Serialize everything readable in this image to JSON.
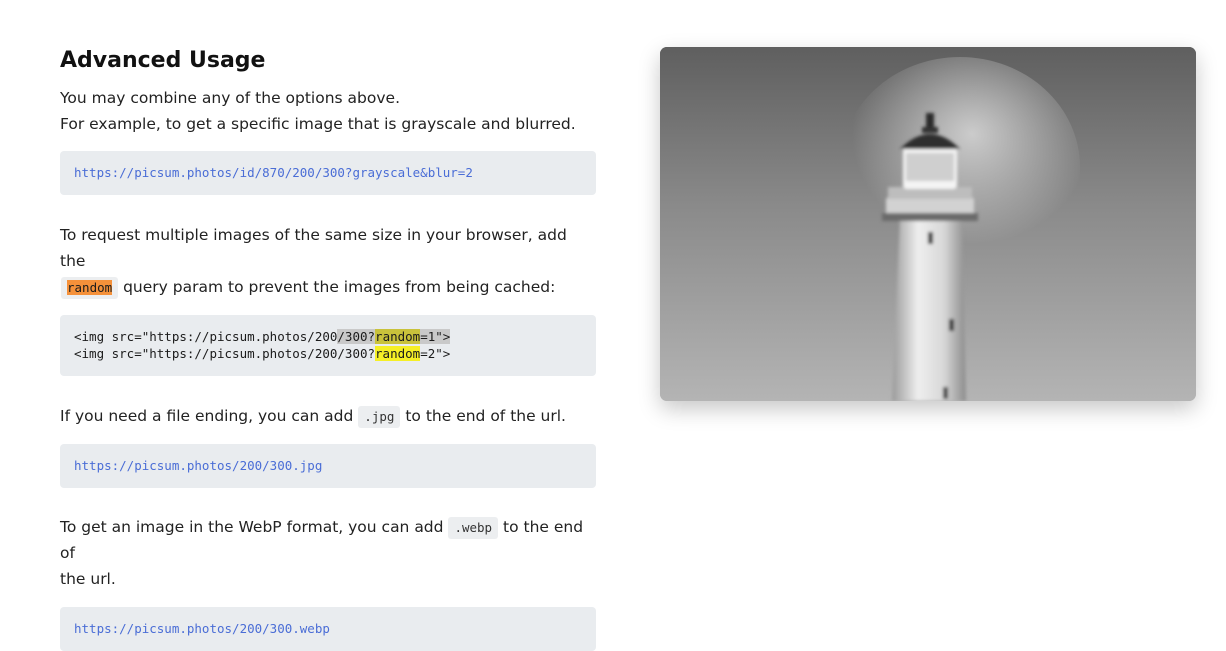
{
  "section": {
    "title": "Advanced Usage",
    "intro_line1": "You may combine any of the options above.",
    "intro_line2": "For example, to get a specific image that is grayscale and blurred."
  },
  "examples": {
    "combined_url": "https://picsum.photos/id/870/200/300?grayscale&blur=2",
    "random_text_before": "To request multiple images of the same size in your browser, add the",
    "random_code": "random",
    "random_text_after": "query param to prevent the images from being cached:",
    "random_line1": {
      "prefix": "<img src=\"https://picsum.photos/200",
      "sel": "/300?",
      "param": "random",
      "suffix": "=1\">"
    },
    "random_line2": {
      "prefix": "<img src=\"https://picsum.photos/200/300?",
      "param": "random",
      "suffix": "=2\">"
    },
    "jpg_text_before": "If you need a file ending, you can add",
    "jpg_code": ".jpg",
    "jpg_text_after": "to the end of the url.",
    "jpg_url": "https://picsum.photos/200/300.jpg",
    "webp_text_before": "To get an image in the WebP format, you can add",
    "webp_code": ".webp",
    "webp_text_after": "to the end of",
    "webp_text_after2": "the url.",
    "webp_url": "https://picsum.photos/200/300.webp"
  },
  "preview": {
    "subject": "blurred grayscale lighthouse"
  },
  "colors": {
    "link_blue": "#4a6dd6",
    "code_bg": "#e9ecef",
    "highlight_orange": "#f5913a",
    "highlight_yellow": "#f5ef26"
  }
}
